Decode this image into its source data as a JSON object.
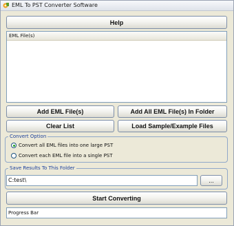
{
  "window": {
    "title": "EML To PST Converter Software",
    "icon": "app-icon"
  },
  "buttons": {
    "help": "Help",
    "add_eml": "Add EML File(s)",
    "add_all_eml": "Add All EML File(s) In Folder",
    "clear_list": "Clear List",
    "load_sample": "Load Sample/Example Files",
    "browse": "...",
    "start": "Start Converting"
  },
  "file_list": {
    "header": "EML File(s)",
    "items": []
  },
  "convert_option": {
    "title": "Convert Option",
    "options": [
      {
        "label": "Convert all EML files into one large PST",
        "checked": true
      },
      {
        "label": "Convert each EML file into a single PST",
        "checked": false
      }
    ]
  },
  "save": {
    "title": "Save Results To This Folder",
    "path": "C:test\\"
  },
  "progress": {
    "label": "Progress Bar"
  },
  "colors": {
    "window_bg": "#ece9d8",
    "group_title": "#1a3f9c",
    "radio_dot": "#21a121"
  }
}
